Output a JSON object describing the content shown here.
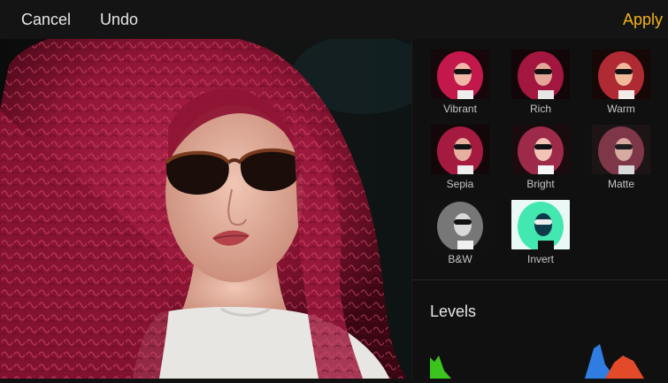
{
  "toolbar": {
    "cancel_label": "Cancel",
    "undo_label": "Undo",
    "apply_label": "Apply",
    "accent_color": "#f3b21b"
  },
  "filters": [
    {
      "label": "Vibrant"
    },
    {
      "label": "Rich"
    },
    {
      "label": "Warm"
    },
    {
      "label": "Sepia"
    },
    {
      "label": "Bright"
    },
    {
      "label": "Matte"
    },
    {
      "label": "B&W"
    },
    {
      "label": "Invert"
    }
  ],
  "levels": {
    "title": "Levels"
  }
}
